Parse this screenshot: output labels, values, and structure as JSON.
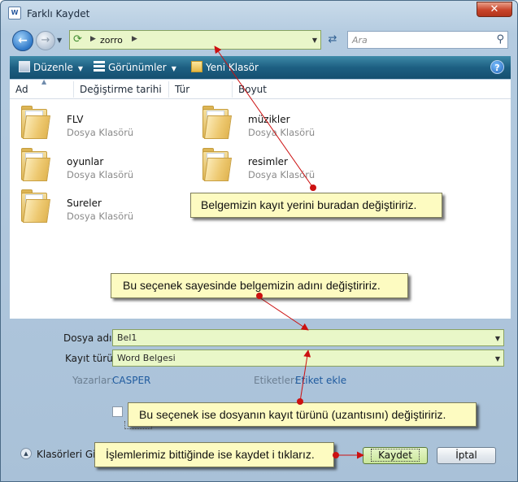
{
  "window": {
    "title": "Farklı Kaydet",
    "app_icon_text": "W",
    "close_label": "✕"
  },
  "address": {
    "path": "zorro",
    "search_placeholder": "Ara"
  },
  "toolbar": {
    "organize": "Düzenle",
    "views": "Görünümler",
    "new_folder": "Yeni Klasör",
    "help": "?"
  },
  "columns": [
    "Ad",
    "Değiştirme tarihi",
    "Tür",
    "Boyut"
  ],
  "files": [
    {
      "name": "FLV",
      "type": "Dosya Klasörü"
    },
    {
      "name": "müzikler",
      "type": "Dosya Klasörü"
    },
    {
      "name": "oyunlar",
      "type": "Dosya Klasörü"
    },
    {
      "name": "resimler",
      "type": "Dosya Klasörü"
    },
    {
      "name": "Sureler",
      "type": "Dosya Klasörü"
    }
  ],
  "form": {
    "filename_label": "Dosya adı:",
    "filename_value": "Bel1",
    "filetype_label": "Kayıt türü:",
    "filetype_value": "Word Belgesi",
    "authors_label": "Yazarlar:",
    "authors_value": "CASPER",
    "tags_label": "Etiketler:",
    "tags_value": "Etiket ekle",
    "hide_folders": "Klasörleri Gizl",
    "save": "Kaydet",
    "cancel": "İptal"
  },
  "callouts": {
    "location": "Belgemizin kayıt yerini buradan değiştiririz.",
    "filename": "Bu seçenek sayesinde belgemizin adını değiştiririz.",
    "filetype": "Bu seçenek ise dosyanın kayıt türünü (uzantısını) değiştiririz.",
    "save": "İşlemlerimiz bittiğinde ise kaydet i tıklarız."
  },
  "colors": {
    "callout_bg": "#fdfbc1",
    "arrow": "#cc1111",
    "field_bg": "#e9f7c8",
    "toolbar": "#1d5f82"
  }
}
